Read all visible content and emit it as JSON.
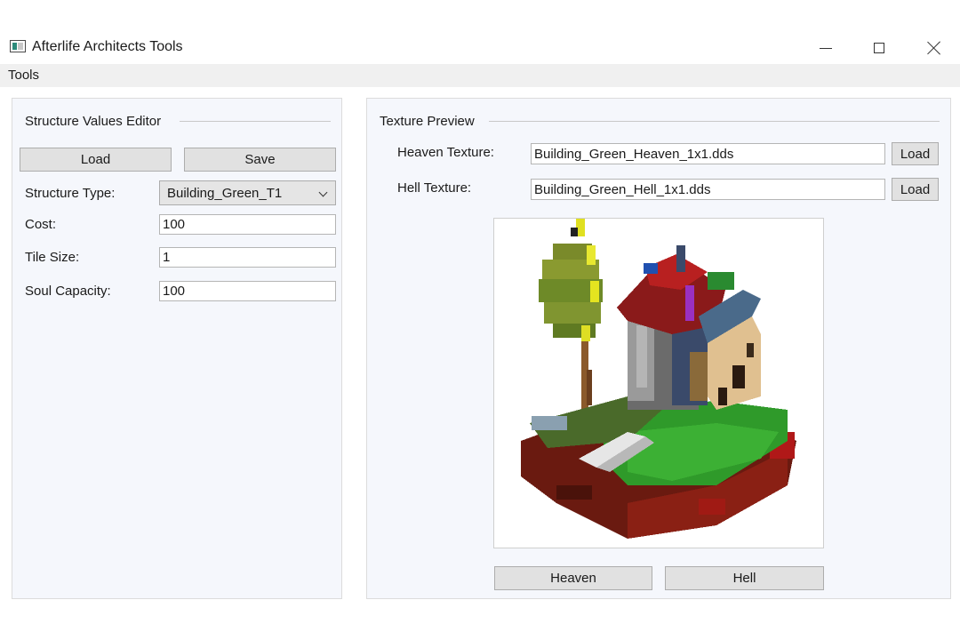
{
  "window": {
    "title": "Afterlife Architects Tools",
    "icon": "app-window-icon",
    "controls": {
      "minimize_icon": "minimize-icon",
      "maximize_icon": "maximize-icon",
      "close_icon": "close-icon"
    }
  },
  "menu": {
    "items": [
      "Tools"
    ]
  },
  "structure_editor": {
    "header": "Structure Values Editor",
    "load_label": "Load",
    "save_label": "Save",
    "fields": {
      "structure_type": {
        "label": "Structure Type:",
        "value": "Building_Green_T1"
      },
      "cost": {
        "label": "Cost:",
        "value": "100"
      },
      "tile_size": {
        "label": "Tile Size:",
        "value": "1"
      },
      "soul_capacity": {
        "label": "Soul Capacity:",
        "value": "100"
      }
    }
  },
  "texture_preview": {
    "header": "Texture Preview",
    "heaven": {
      "label": "Heaven Texture:",
      "value": "Building_Green_Heaven_1x1.dds",
      "load_label": "Load"
    },
    "hell": {
      "label": "Hell Texture:",
      "value": "Building_Green_Hell_1x1.dds",
      "load_label": "Load"
    },
    "image": "pixel-art-building-preview",
    "heaven_button": "Heaven",
    "hell_button": "Hell"
  },
  "colors": {
    "panel_bg": "#f5f7fc",
    "button_bg": "#e1e1e1",
    "menu_bg": "#f0f0f0",
    "grass_green": "#2f9a2a",
    "dirt_red": "#7a1a12"
  }
}
